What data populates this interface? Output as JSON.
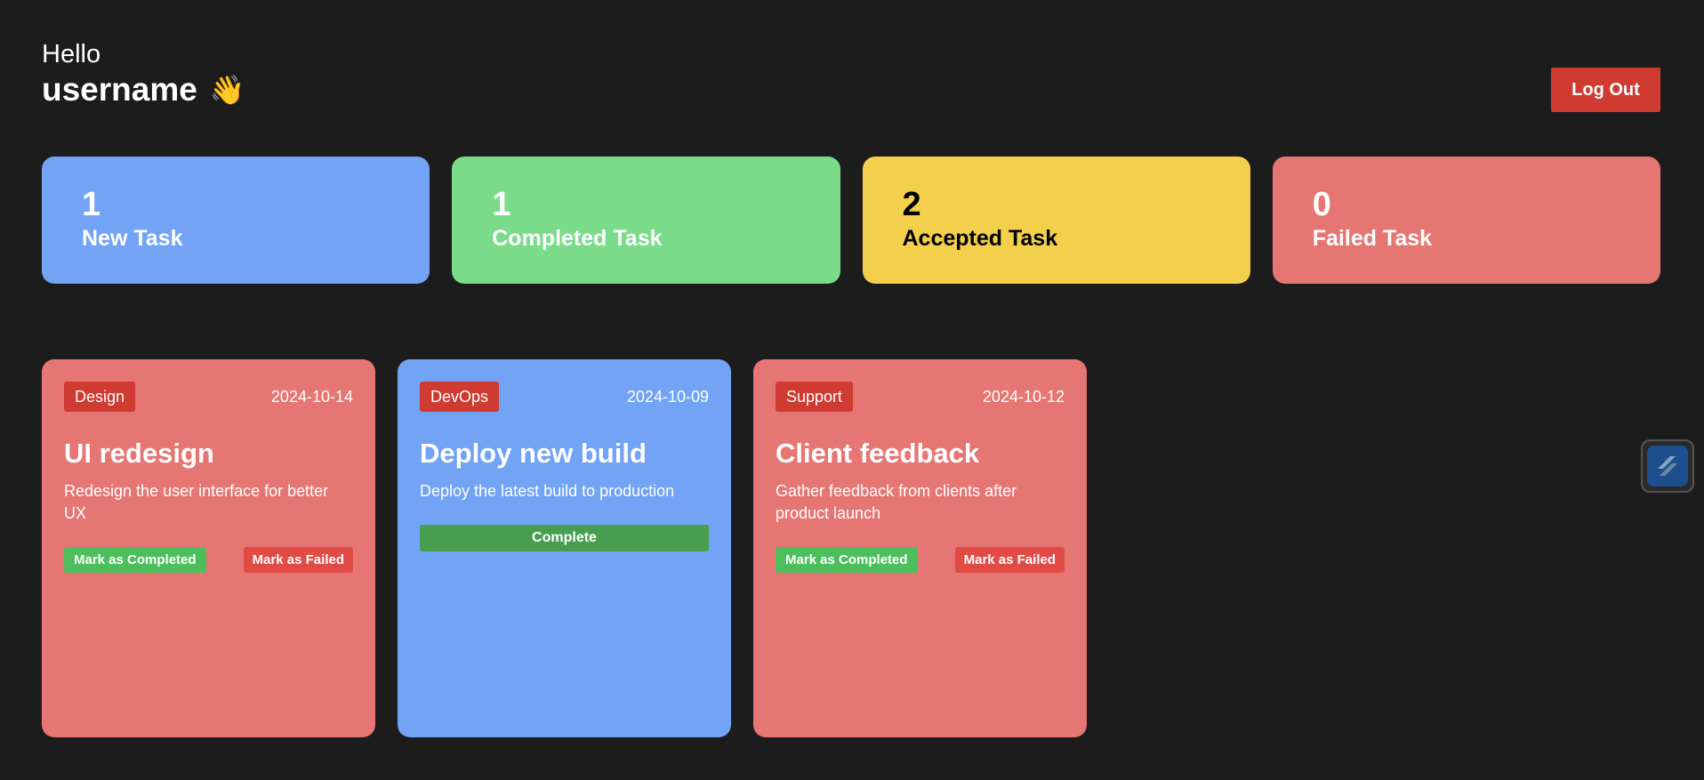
{
  "header": {
    "greeting": "Hello",
    "username": "username",
    "wave_emoji": "👋",
    "logout_label": "Log Out"
  },
  "stats": [
    {
      "count": "1",
      "label": "New Task",
      "color": "#72a3f5",
      "text_color": "#ffffff"
    },
    {
      "count": "1",
      "label": "Completed Task",
      "color": "#7adb8a",
      "text_color": "#ffffff"
    },
    {
      "count": "2",
      "label": "Accepted Task",
      "color": "#f3cf4c",
      "text_color": "#000000"
    },
    {
      "count": "0",
      "label": "Failed Task",
      "color": "#e67673",
      "text_color": "#ffffff"
    }
  ],
  "tasks": [
    {
      "category": "Design",
      "date": "2024-10-14",
      "title": "UI redesign",
      "description": "Redesign the user interface for better UX",
      "mark_completed_label": "Mark as Completed",
      "mark_failed_label": "Mark as Failed",
      "card_color": "#e67673"
    },
    {
      "category": "DevOps",
      "date": "2024-10-09",
      "title": "Deploy new build",
      "description": "Deploy the latest build to production",
      "complete_label": "Complete",
      "card_color": "#72a3f5"
    },
    {
      "category": "Support",
      "date": "2024-10-12",
      "title": "Client feedback",
      "description": "Gather feedback from clients after product launch",
      "mark_completed_label": "Mark as Completed",
      "mark_failed_label": "Mark as Failed",
      "card_color": "#e67673"
    }
  ],
  "floating_widget": {
    "icon": "extension-s-icon"
  },
  "colors": {
    "background": "#1c1c1c",
    "accent_red": "#cf3a31",
    "success_green": "#4cbf5c",
    "failed_red": "#e24b45"
  }
}
